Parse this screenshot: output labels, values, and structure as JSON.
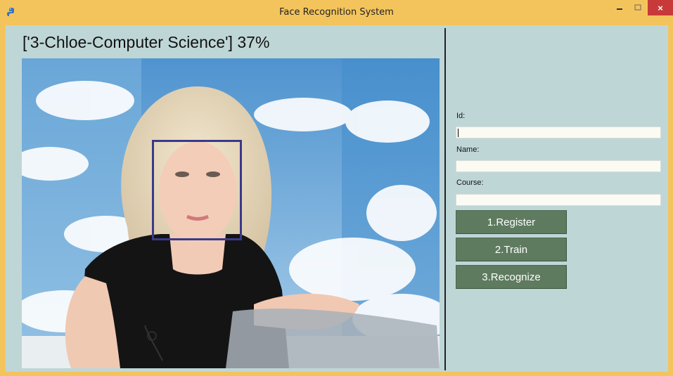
{
  "window": {
    "title": "Face Recognition System",
    "close_glyph": "×"
  },
  "recognition": {
    "result_text": "['3-Chloe-Computer Science'] 37%"
  },
  "form": {
    "id_label": "Id:",
    "id_value": "",
    "name_label": "Name:",
    "name_value": "",
    "course_label": "Course:",
    "course_value": ""
  },
  "buttons": {
    "register": "1.Register",
    "train": "2.Train",
    "recognize": "3.Recognize"
  },
  "colors": {
    "titlebar": "#f4c45c",
    "client_bg": "#bfd6d7",
    "button_bg": "#5e7b5f",
    "close_bg": "#c8393a",
    "face_box": "#3a3a8a"
  },
  "icons": [
    "python-app-icon",
    "minimize-icon",
    "maximize-icon",
    "close-icon"
  ]
}
